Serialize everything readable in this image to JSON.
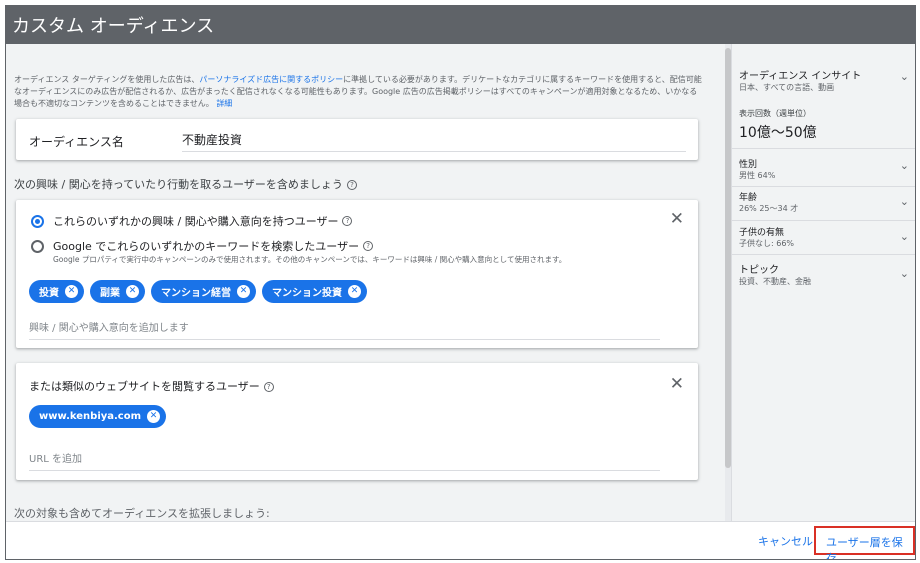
{
  "dialog": {
    "title": "カスタム オーディエンス"
  },
  "intro": {
    "text_before": "オーディエンス ターゲティングを使用した広告は、",
    "policy_link": "パーソナライズド広告に関するポリシー",
    "text_after": "に準拠している必要があります。デリケートなカテゴリに属するキーワードを使用すると、配信可能なオーディエンスにのみ広告が配信されるか、広告がまったく配信されなくなる可能性もあります。Google 広告の広告掲載ポリシーはすべてのキャンペーンが適用対象となるため、いかなる場合も不適切なコンテンツを含めることはできません。",
    "details_link": "詳細"
  },
  "audience_name": {
    "label": "オーディエンス名",
    "value": "不動産投資"
  },
  "interests_section": {
    "label": "次の興味 / 関心を持っていたり行動を取るユーザーを含めましょう",
    "help_icon": "?",
    "option_interest": "これらのいずれかの興味 / 関心や購入意向を持つユーザー",
    "option_search": "Google でこれらのいずれかのキーワードを検索したユーザー",
    "option_search_sub": "Google プロパティで実行中のキャンペーンのみで使用されます。その他のキャンペーンでは、キーワードは興味 / 関心や購入意向として使用されます。",
    "close": "✕",
    "chips": [
      "投資",
      "副業",
      "マンション経営",
      "マンション投資"
    ],
    "chip_remove": "✕",
    "add_placeholder": "興味 / 関心や購入意向を追加します"
  },
  "sites_section": {
    "heading": "または類似のウェブサイトを閲覧するユーザー",
    "help_icon": "?",
    "close": "✕",
    "chips": [
      "www.kenbiya.com"
    ],
    "chip_remove": "✕",
    "url_placeholder": "URL を追加"
  },
  "expand_label": "次の対象も含めてオーディエンスを拡張しましょう:",
  "insights": {
    "title": "オーディエンス インサイト",
    "subtitle": "日本、すべての言語、動画",
    "impressions_label": "表示回数（週単位）",
    "impressions_value": "10億〜50億",
    "chevron": "⌄",
    "gender_label": "性別",
    "gender_value": "男性 64%",
    "age_label": "年齢",
    "age_value": "26% 25〜34 才",
    "children_label": "子供の有無",
    "children_value": "子供なし: 66%",
    "topic_label": "トピック",
    "topic_value": "投資、不動産、金融"
  },
  "footer": {
    "cancel": "キャンセル",
    "save": "ユーザー層を保存"
  },
  "colors": {
    "accent": "#1a73e8",
    "titlebar": "#5f6368",
    "highlight": "#d93025"
  }
}
